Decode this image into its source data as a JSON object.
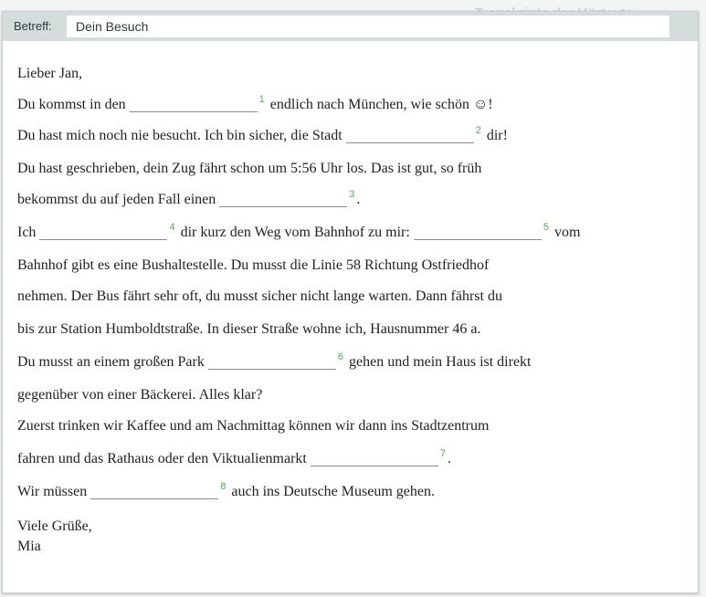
{
  "letter": {
    "subject_label": "Betreff:",
    "subject_value": "Dein Besuch",
    "background_heading": "Transkripte der Hörtexte",
    "greeting": "Lieber Jan,",
    "lines": [
      {
        "before": "Du kommst in den",
        "gap_no": "1",
        "after": "endlich nach München, wie schön ☺!"
      },
      {
        "before": "Du hast mich noch nie besucht. Ich bin sicher, die Stadt",
        "gap_no": "2",
        "after": "dir!"
      },
      {
        "text": "Du hast geschrieben, dein Zug fährt schon um 5:56 Uhr los. Das ist gut, so früh"
      },
      {
        "before": "bekommst du auf jeden Fall einen",
        "gap_no": "3",
        "after": "."
      },
      {
        "before": "Ich",
        "gap_no": "4",
        "middle": "dir kurz den Weg vom Bahnhof zu mir:",
        "gap2_no": "5",
        "after": "vom"
      },
      {
        "text": "Bahnhof gibt es eine Bushaltestelle. Du musst die Linie 58 Richtung Ostfriedhof"
      },
      {
        "text": "nehmen. Der Bus fährt sehr oft, du musst sicher nicht lange warten. Dann fährst du"
      },
      {
        "text": "bis zur Station Humboldtstraße. In dieser Straße wohne ich, Hausnummer 46 a."
      },
      {
        "before": "Du musst an einem großen Park",
        "gap_no": "6",
        "after": "gehen und mein Haus ist direkt"
      },
      {
        "text": "gegenüber von einer Bäckerei. Alles klar?"
      },
      {
        "text": "Zuerst trinken wir Kaffee und am Nachmittag können wir dann ins Stadtzentrum"
      },
      {
        "before": "fahren und das Rathaus oder den Viktualienmarkt",
        "gap_no": "7",
        "after": "."
      },
      {
        "before": "Wir müssen",
        "gap_no": "8",
        "after": "auch ins Deutsche Museum gehen."
      }
    ],
    "closing": "Viele Grüße,",
    "signature": "Mia"
  },
  "colors": {
    "gap_number": "#5aa85a",
    "subject_bar": "#d4dcdc"
  }
}
